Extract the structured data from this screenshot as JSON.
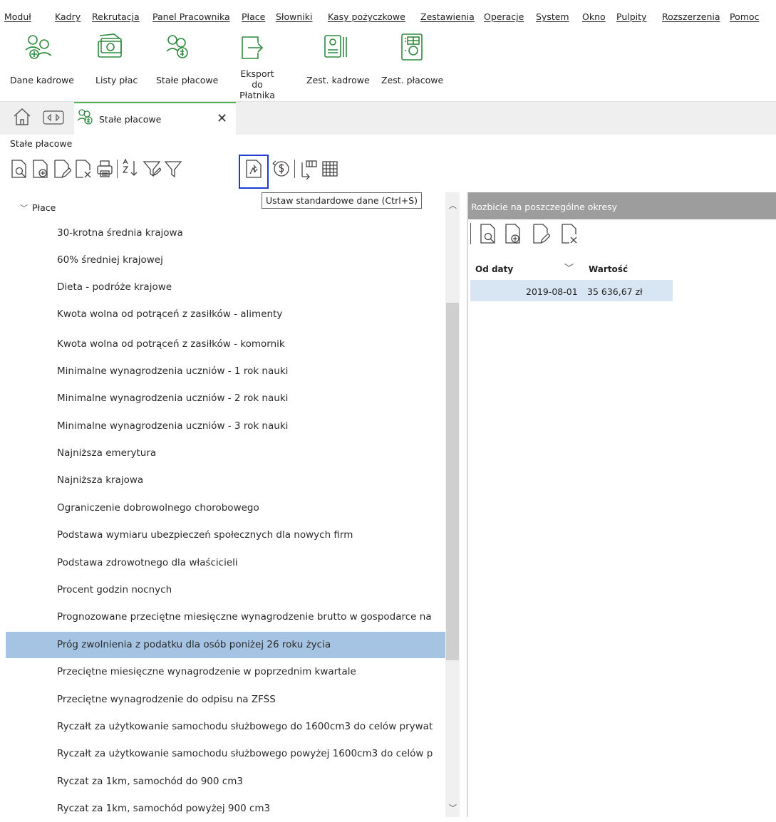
{
  "menu": [
    "Moduł",
    "Kadry",
    "Rekrutacja",
    "Panel Pracownika",
    "Płace",
    "Słowniki",
    "Kasy pożyczkowe",
    "Zestawienia",
    "Operacje",
    "System",
    "Okno",
    "Pulpity",
    "Rozszerzenia",
    "Pomoc"
  ],
  "ribbon": {
    "dane_kadrowe": "Dane kadrowe",
    "listy_plac": "Listy płac",
    "stale_placowe": "Stałe płacowe",
    "eksport_line1": "Eksport do",
    "eksport_line2": "Płatnika",
    "zest_kadrowe": "Zest. kadrowe",
    "zest_placowe": "Zest. płacowe"
  },
  "tab": {
    "label": "Stałe płacowe",
    "close": "✕"
  },
  "page_title": "Stałe płacowe",
  "tooltip": "Ustaw standardowe dane (Ctrl+S)",
  "tree": {
    "root": "Płace",
    "items": [
      "30-krotna średnia krajowa",
      "60% średniej krajowej",
      "Dieta - podróże krajowe",
      "Kwota wolna od potrąceń z zasiłków - alimenty",
      "Kwota wolna od potrąceń z zasiłków - komornik",
      "Minimalne wynagrodzenia uczniów - 1 rok nauki",
      "Minimalne wynagrodzenia uczniów - 2 rok nauki",
      "Minimalne wynagrodzenia uczniów - 3 rok nauki",
      "Najniższa emerytura",
      "Najniższa krajowa",
      "Ograniczenie dobrowolnego chorobowego",
      "Podstawa wymiaru ubezpieczeń społecznych dla nowych firm",
      "Podstawa zdrowotnego dla właścicieli",
      "Procent godzin nocnych",
      "Prognozowane przeciętne miesięczne wynagrodzenie brutto w gospodarce na",
      "Próg zwolnienia z podatku dla osób poniżej 26 roku życia",
      "Przeciętne miesięczne wynagrodzenie w poprzednim kwartale",
      "Przeciętne wynagrodzenie do odpisu na ZFŚS",
      "Ryczałt za użytkowanie samochodu służbowego do 1600cm3 do celów prywat",
      "Ryczałt za użytkowanie samochodu służbowego powyżej 1600cm3 do celów p",
      "Ryczat za 1km, samochód do 900 cm3",
      "Ryczat za 1km, samochód powyżej 900 cm3"
    ],
    "selected_index": 15
  },
  "right_panel": {
    "title": "Rozbicie na poszczególne okresy",
    "col_od_daty": "Od daty",
    "col_wartosc": "Wartość",
    "rows": [
      {
        "date": "2019-08-01",
        "value": "35 636,67 zł"
      }
    ]
  },
  "colors": {
    "accent_green": "#4caf50",
    "selection": "#a5c3e2",
    "highlight_box": "#1f3bd6",
    "panel_header": "#9d9d9d"
  }
}
